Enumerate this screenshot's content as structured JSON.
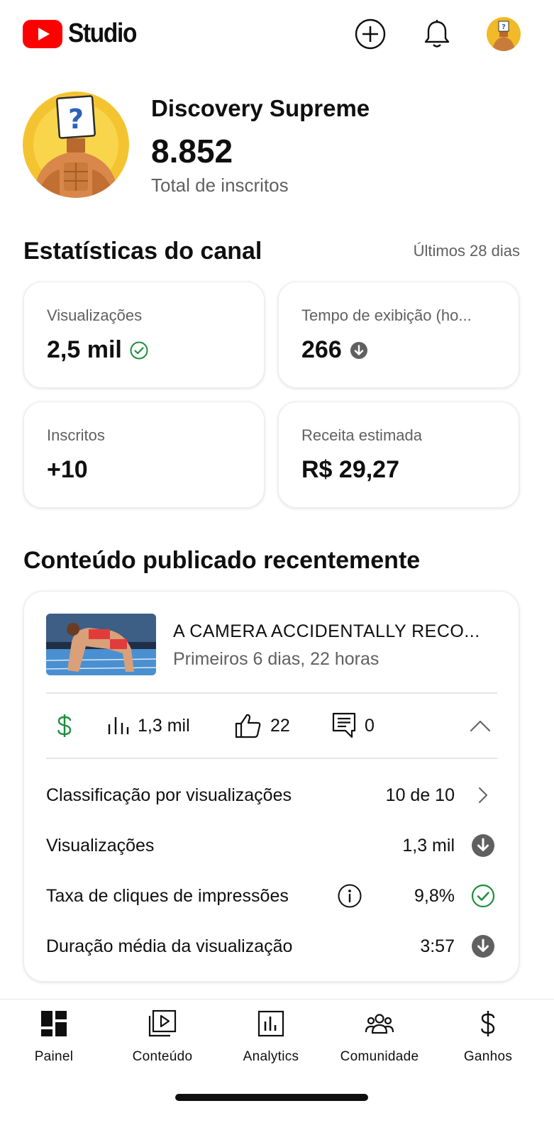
{
  "app": {
    "logo_text": "Studio"
  },
  "channel": {
    "name": "Discovery Supreme",
    "subscriber_count": "8.852",
    "subscriber_label": "Total de inscritos"
  },
  "stats": {
    "title": "Estatísticas do canal",
    "range": "Últimos 28 dias",
    "cards": [
      {
        "label": "Visualizações",
        "value": "2,5 mil",
        "badge": "check-circle-outline"
      },
      {
        "label": "Tempo de exibição (ho...",
        "value": "266",
        "badge": "arrow-down-circle"
      },
      {
        "label": "Inscritos",
        "value": "+10"
      },
      {
        "label": "Receita estimada",
        "value": "R$ 29,27"
      }
    ]
  },
  "recent": {
    "title": "Conteúdo publicado recentemente",
    "video": {
      "title": "A CAMERA ACCIDENTALLY RECO...",
      "age": "Primeiros 6 dias, 22 horas"
    },
    "metrics": {
      "views": "1,3 mil",
      "likes": "22",
      "comments": "0"
    },
    "details": [
      {
        "label": "Classificação por visualizações",
        "value": "10 de 10",
        "icon": "chevron-right"
      },
      {
        "label": "Visualizações",
        "value": "1,3 mil",
        "icon": "arrow-down-circle"
      },
      {
        "label": "Taxa de cliques de impressões",
        "value": "9,8%",
        "icon": "check-circle-outline"
      },
      {
        "label": "Duração média da visualização",
        "value": "3:57",
        "icon": "arrow-down-circle"
      }
    ]
  },
  "nav": {
    "items": [
      {
        "label": "Painel",
        "icon": "dashboard-icon"
      },
      {
        "label": "Conteúdo",
        "icon": "content-icon"
      },
      {
        "label": "Analytics",
        "icon": "analytics-icon"
      },
      {
        "label": "Comunidade",
        "icon": "community-icon"
      },
      {
        "label": "Ganhos",
        "icon": "dollar-icon"
      }
    ]
  },
  "colors": {
    "brand_red": "#ff0000",
    "success_green": "#1e8e3e",
    "icon_gray": "#606060"
  }
}
